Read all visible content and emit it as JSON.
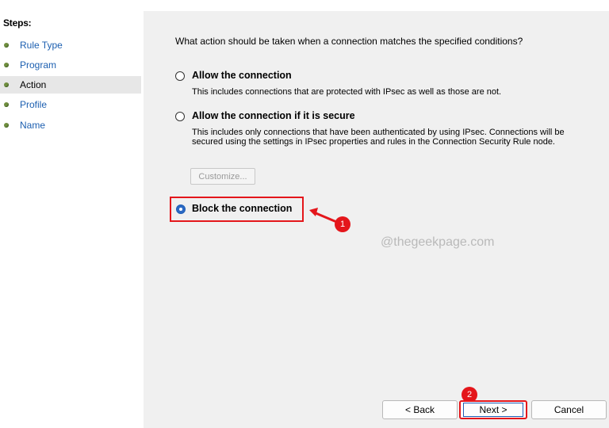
{
  "steps": {
    "title": "Steps:",
    "items": [
      {
        "label": "Rule Type"
      },
      {
        "label": "Program"
      },
      {
        "label": "Action"
      },
      {
        "label": "Profile"
      },
      {
        "label": "Name"
      }
    ]
  },
  "content": {
    "question": "What action should be taken when a connection matches the specified conditions?",
    "options": [
      {
        "label": "Allow the connection",
        "description": "This includes connections that are protected with IPsec as well as those are not."
      },
      {
        "label": "Allow the connection if it is secure",
        "description": "This includes only connections that have been authenticated by using IPsec.  Connections will be secured using the settings in IPsec properties and rules in the Connection Security Rule node."
      },
      {
        "label": "Block the connection",
        "description": ""
      }
    ],
    "customize_label": "Customize...",
    "watermark": "@thegeekpage.com"
  },
  "annotations": {
    "badge1": "1",
    "badge2": "2",
    "color": "#e4161b"
  },
  "buttons": {
    "back": "< Back",
    "next": "Next >",
    "cancel": "Cancel"
  }
}
